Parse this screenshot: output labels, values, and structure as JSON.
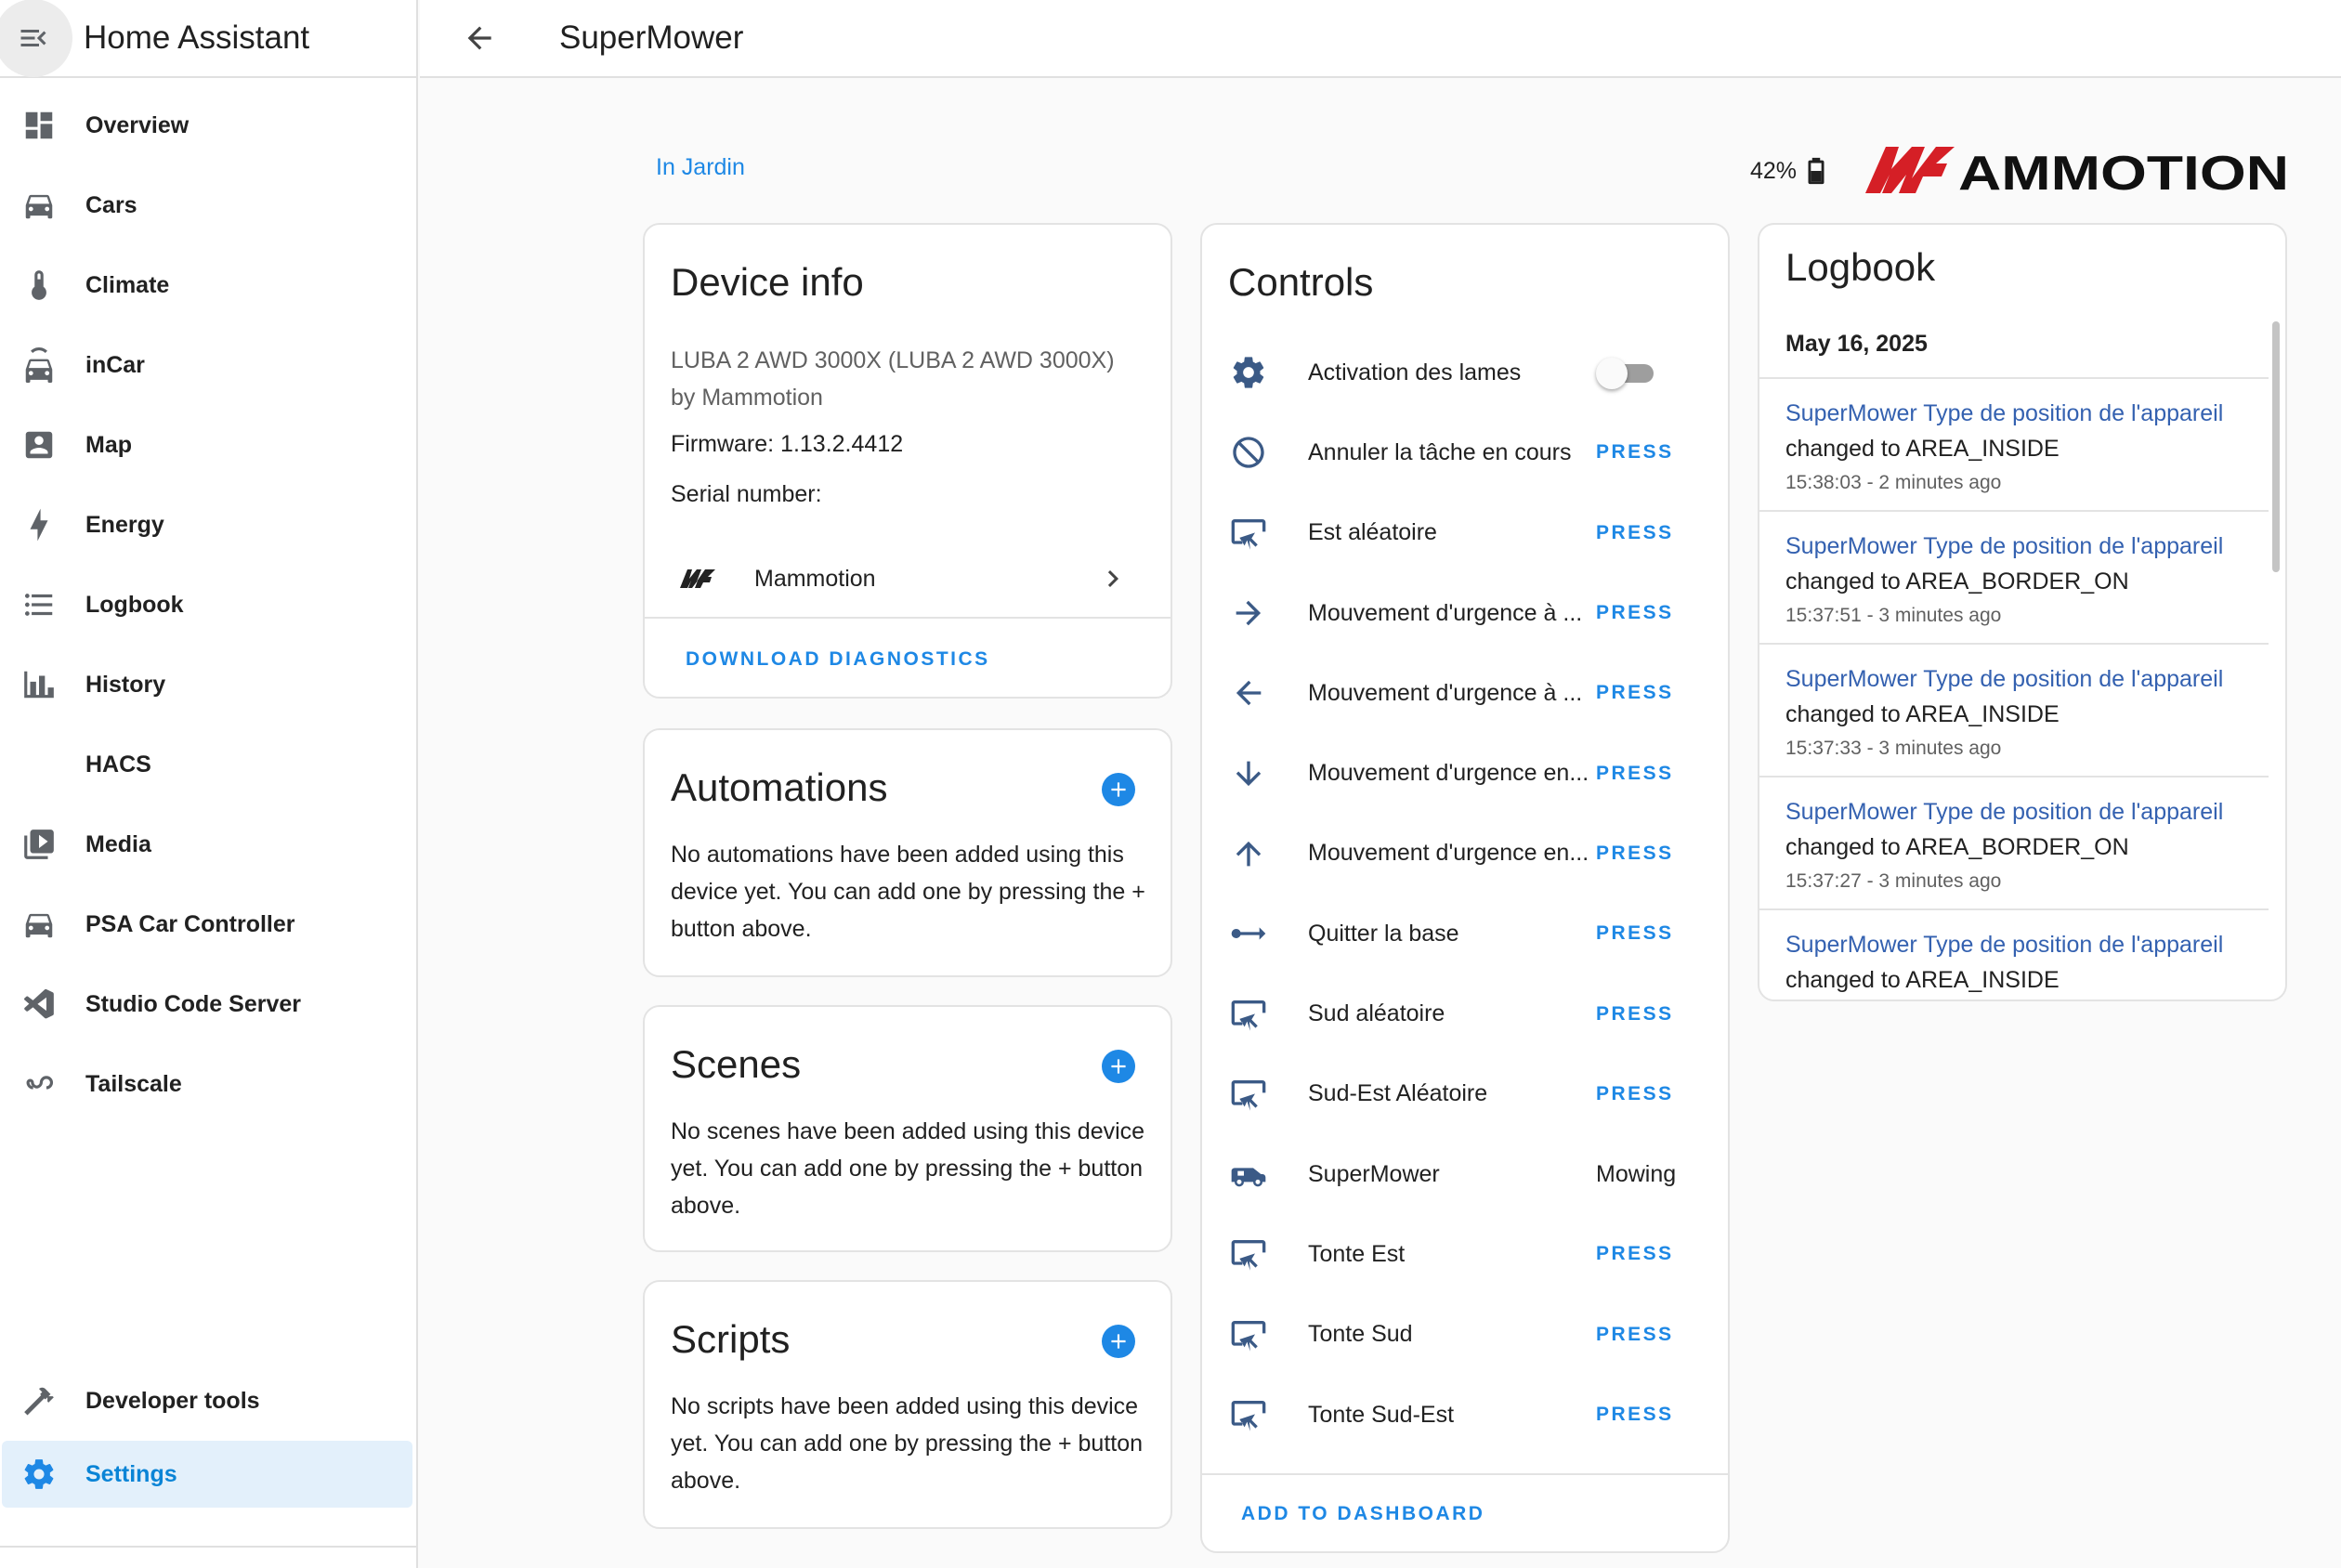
{
  "app": {
    "title": "Home Assistant"
  },
  "sidebar": {
    "items": [
      {
        "label": "Overview",
        "icon": "overview-icon"
      },
      {
        "label": "Cars",
        "icon": "car-icon"
      },
      {
        "label": "Climate",
        "icon": "thermometer-icon"
      },
      {
        "label": "inCar",
        "icon": "car-front-icon"
      },
      {
        "label": "Map",
        "icon": "map-account-icon"
      },
      {
        "label": "Energy",
        "icon": "lightning-icon"
      },
      {
        "label": "Logbook",
        "icon": "list-icon"
      },
      {
        "label": "History",
        "icon": "chart-icon"
      },
      {
        "label": "HACS",
        "icon": ""
      },
      {
        "label": "Media",
        "icon": "play-box-icon"
      },
      {
        "label": "PSA Car Controller",
        "icon": "car-side-icon"
      },
      {
        "label": "Studio Code Server",
        "icon": "vscode-icon"
      },
      {
        "label": "Tailscale",
        "icon": "tailscale-icon"
      }
    ],
    "bottom": [
      {
        "label": "Developer tools",
        "icon": "hammer-icon"
      },
      {
        "label": "Settings",
        "icon": "gear-icon",
        "active": true
      }
    ]
  },
  "header": {
    "title": "SuperMower"
  },
  "area": {
    "link": "In Jardin"
  },
  "battery": {
    "level": "42%"
  },
  "brand": {
    "name": "MAMMOTION",
    "color": "#d51f26"
  },
  "device_info": {
    "title": "Device info",
    "model": "LUBA 2 AWD 3000X (LUBA 2 AWD 3000X)",
    "manufacturer": "by Mammotion",
    "firmware": "Firmware: 1.13.2.4412",
    "serial": "Serial number:",
    "integration": "Mammotion",
    "download": "DOWNLOAD DIAGNOSTICS"
  },
  "automations": {
    "title": "Automations",
    "text": "No automations have been added using this device yet. You can add one by pressing the + button above."
  },
  "scenes": {
    "title": "Scenes",
    "text": "No scenes have been added using this device yet. You can add one by pressing the + button above."
  },
  "scripts": {
    "title": "Scripts",
    "text": "No scripts have been added using this device yet. You can add one by pressing the + button above."
  },
  "controls": {
    "title": "Controls",
    "press_label": "PRESS",
    "rows": [
      {
        "name": "Activation des lames",
        "icon": "gear-icon",
        "kind": "toggle",
        "on": false
      },
      {
        "name": "Annuler la tâche en cours",
        "icon": "cancel-icon",
        "kind": "press"
      },
      {
        "name": "Est aléatoire",
        "icon": "gesture-tap-icon",
        "kind": "press"
      },
      {
        "name": "Mouvement d'urgence à ...",
        "icon": "arrow-right-icon",
        "kind": "press"
      },
      {
        "name": "Mouvement d'urgence à ...",
        "icon": "arrow-left-icon",
        "kind": "press"
      },
      {
        "name": "Mouvement d'urgence en...",
        "icon": "arrow-down-icon",
        "kind": "press"
      },
      {
        "name": "Mouvement d'urgence en...",
        "icon": "arrow-up-icon",
        "kind": "press"
      },
      {
        "name": "Quitter la base",
        "icon": "ray-start-arrow-icon",
        "kind": "press"
      },
      {
        "name": "Sud aléatoire",
        "icon": "gesture-tap-icon",
        "kind": "press"
      },
      {
        "name": "Sud-Est Aléatoire",
        "icon": "gesture-tap-icon",
        "kind": "press"
      },
      {
        "name": "SuperMower",
        "icon": "robot-mower-icon",
        "kind": "state",
        "state": "Mowing"
      },
      {
        "name": "Tonte Est",
        "icon": "gesture-tap-icon",
        "kind": "press"
      },
      {
        "name": "Tonte Sud",
        "icon": "gesture-tap-icon",
        "kind": "press"
      },
      {
        "name": "Tonte Sud-Est",
        "icon": "gesture-tap-icon",
        "kind": "press"
      }
    ],
    "footer": "ADD TO DASHBOARD"
  },
  "logbook": {
    "title": "Logbook",
    "date": "May 16, 2025",
    "entries": [
      {
        "entity": "SuperMower Type de position de l'appareil",
        "change": "changed to AREA_INSIDE",
        "time": "15:38:03 - 2 minutes ago"
      },
      {
        "entity": "SuperMower Type de position de l'appareil",
        "change": "changed to AREA_BORDER_ON",
        "time": "15:37:51 - 3 minutes ago"
      },
      {
        "entity": "SuperMower Type de position de l'appareil",
        "change": "changed to AREA_INSIDE",
        "time": "15:37:33 - 3 minutes ago"
      },
      {
        "entity": "SuperMower Type de position de l'appareil",
        "change": "changed to AREA_BORDER_ON",
        "time": "15:37:27 - 3 minutes ago"
      },
      {
        "entity": "SuperMower Type de position de l'appareil",
        "change": "changed to AREA_INSIDE",
        "time": ""
      }
    ]
  }
}
